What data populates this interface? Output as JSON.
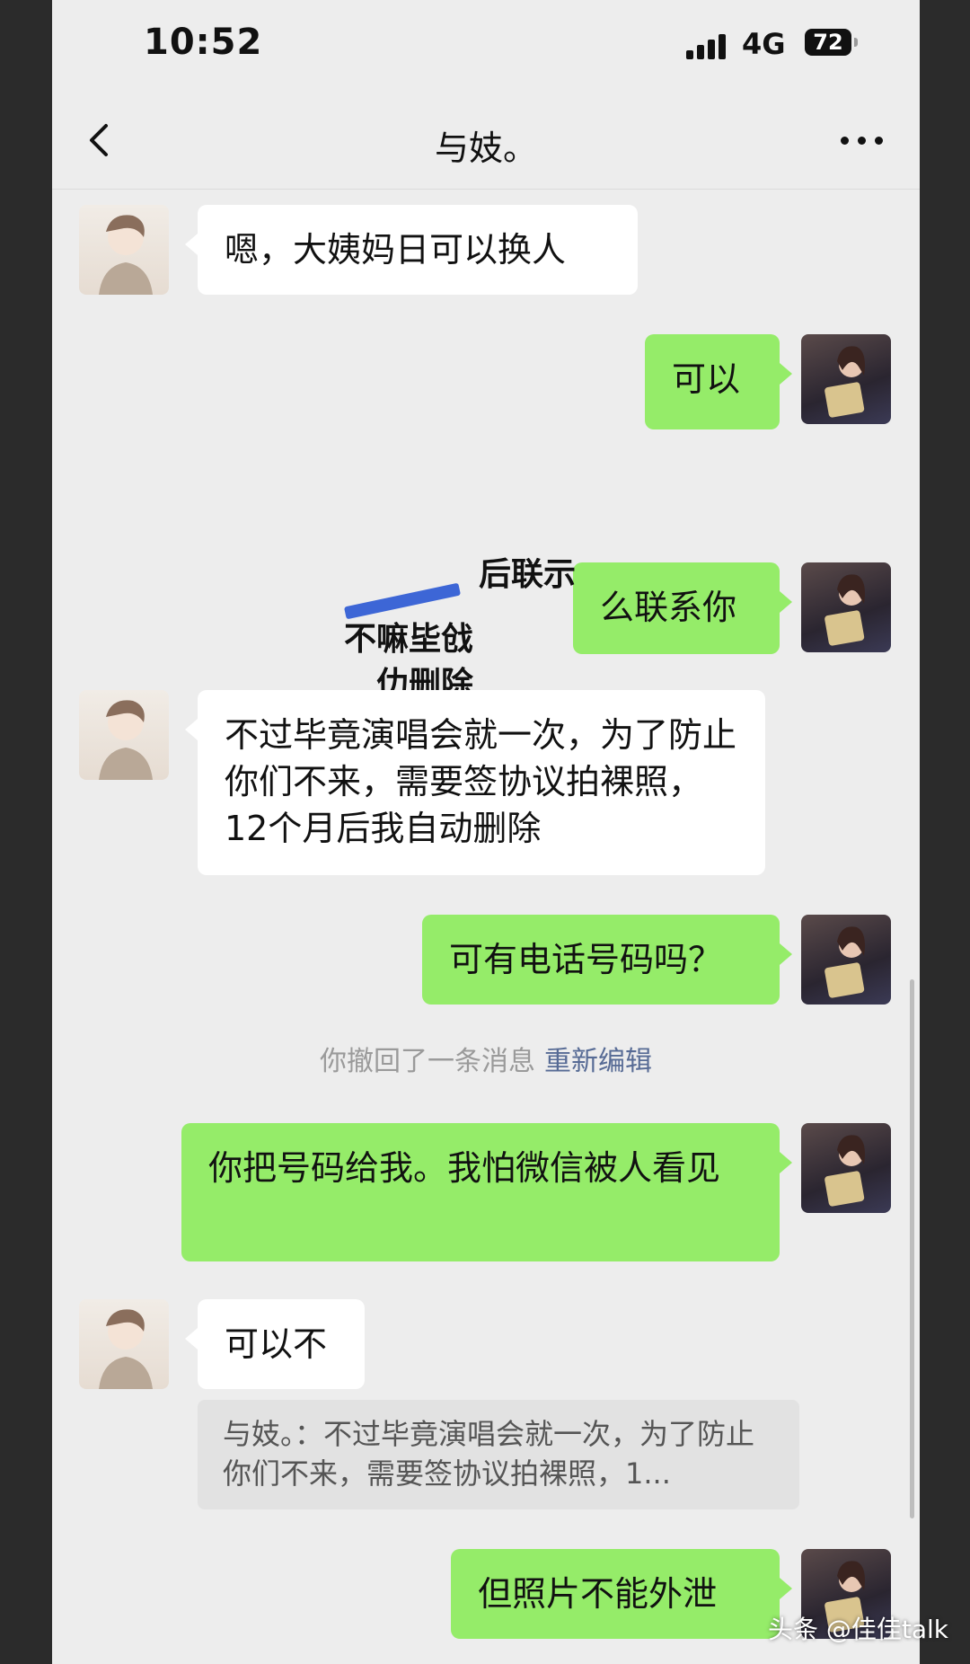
{
  "status_bar": {
    "time": "10:52",
    "network": "4G",
    "battery": "72"
  },
  "nav": {
    "title": "与妓。"
  },
  "messages": [
    {
      "side": "left",
      "text": "嗯，大姨妈日可以换人"
    },
    {
      "side": "right",
      "text": "可以"
    },
    {
      "side": "right",
      "text": "么联系你"
    },
    {
      "side": "left",
      "text": "不过毕竟演唱会就一次，为了防止你们不来，需要签协议拍裸照，12个月后我自动删除"
    },
    {
      "side": "right",
      "text": "可有电话号码吗？"
    },
    {
      "side": "right",
      "text": "你把号码给我。我怕微信被人看见"
    },
    {
      "side": "left",
      "text": "可以不"
    },
    {
      "side": "right",
      "text": "但照片不能外泄"
    }
  ],
  "overlay": {
    "line1": "后联示",
    "line2": "不嘛坒戗",
    "line3": "仂删除"
  },
  "recall": {
    "text": "你撤回了一条消息",
    "action": "重新编辑"
  },
  "quote": {
    "text": "与妓。：不过毕竟演唱会就一次，为了防止你们不来，需要签协议拍裸照，1..."
  },
  "watermark": "头条 @佳佳talk",
  "colors": {
    "sent_bubble": "#95ec69",
    "received_bubble": "#ffffff",
    "background": "#ededed",
    "link": "#576b95"
  }
}
